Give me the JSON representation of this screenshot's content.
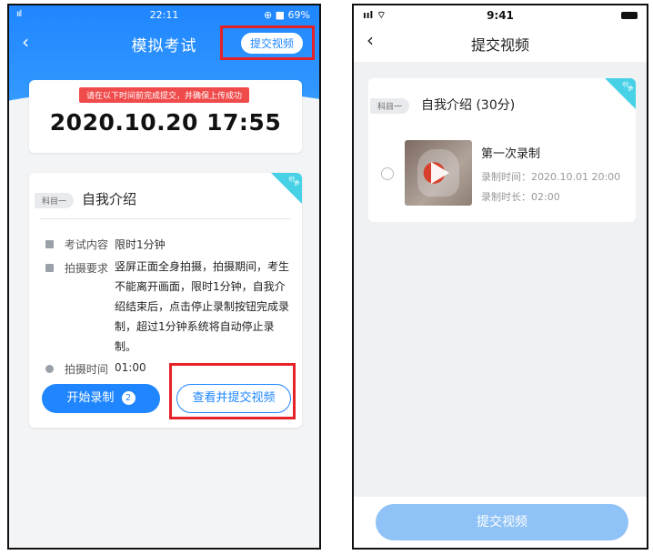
{
  "left_screen": {
    "status": {
      "signal": "ııl",
      "time": "22:11",
      "battery": "⊕ ■ 69%"
    },
    "header": {
      "back_icon": "chevron-left-icon",
      "title": "模拟考试",
      "submit_label": "提交视频"
    },
    "deadline_card": {
      "notice": "请在以下时间前完成提交，并确保上传成功",
      "deadline": "2020.10.20 17:55"
    },
    "exam_card": {
      "corner_tag": "必考",
      "subject_tag": "科目一",
      "subject_name": "自我介绍",
      "content_label": "考试内容",
      "content_value": "限时1分钟",
      "requirement_label": "拍摄要求",
      "requirement_text": "竖屏正面全身拍摄，拍摄期间，考生不能离开画面，限时1分钟，自我介绍结束后，点击停止录制按钮完成录制，超过1分钟系统将自动停止录制。",
      "time_label": "拍摄时间",
      "time_value": "01:00",
      "start_label": "开始录制",
      "start_badge": "2",
      "view_label": "查看并提交视频"
    },
    "highlight_color": "#e52228"
  },
  "right_screen": {
    "status": {
      "signal": "ııl ⌔",
      "time": "9:41"
    },
    "header": {
      "back_icon": "chevron-left-icon",
      "title": "提交视频"
    },
    "video_card": {
      "corner_tag": "必考",
      "subject_tag": "科目一",
      "subject_name": "自我介绍 (30分)",
      "record_title": "第一次录制",
      "record_time": "录制时间：2020.10.01 20:00",
      "record_duration": "录制时长：02:00"
    },
    "submit_label": "提交视频"
  },
  "colors": {
    "brand_blue": "#1f86ff",
    "cyan_tag": "#46d1e6",
    "disabled_blue": "#8fc2f7"
  }
}
